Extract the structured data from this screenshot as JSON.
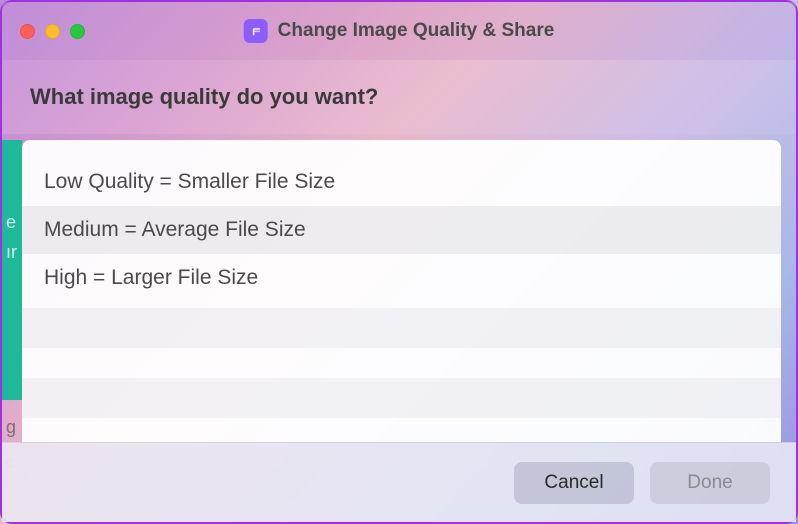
{
  "titlebar": {
    "title": "Change Image Quality & Share"
  },
  "prompt": {
    "heading": "What image quality do you want?"
  },
  "options": [
    {
      "label": "Low Quality = Smaller File Size",
      "selected": false
    },
    {
      "label": "Medium = Average File Size",
      "selected": true
    },
    {
      "label": "High = Larger File Size",
      "selected": false
    }
  ],
  "buttons": {
    "cancel": "Cancel",
    "done": "Done"
  }
}
